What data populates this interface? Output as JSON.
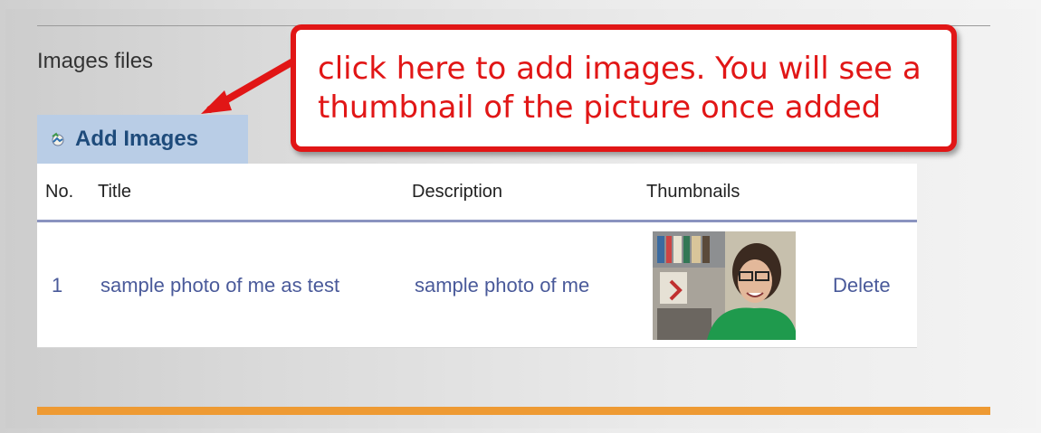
{
  "section": {
    "title": "Images files"
  },
  "add_button": {
    "label": "Add Images"
  },
  "callout": {
    "text": "click here to add images.  You will see a thumbnail of the picture once added"
  },
  "table": {
    "headers": {
      "no": "No.",
      "title": "Title",
      "description": "Description",
      "thumbnails": "Thumbnails"
    },
    "rows": [
      {
        "no": "1",
        "title": "sample photo of me as test",
        "description": "sample photo of me",
        "action": "Delete"
      }
    ]
  },
  "colors": {
    "accent_blue": "#b9cde6",
    "link": "#4a5a9a",
    "callout_red": "#e11616",
    "footer_orange": "#ee9a33"
  }
}
